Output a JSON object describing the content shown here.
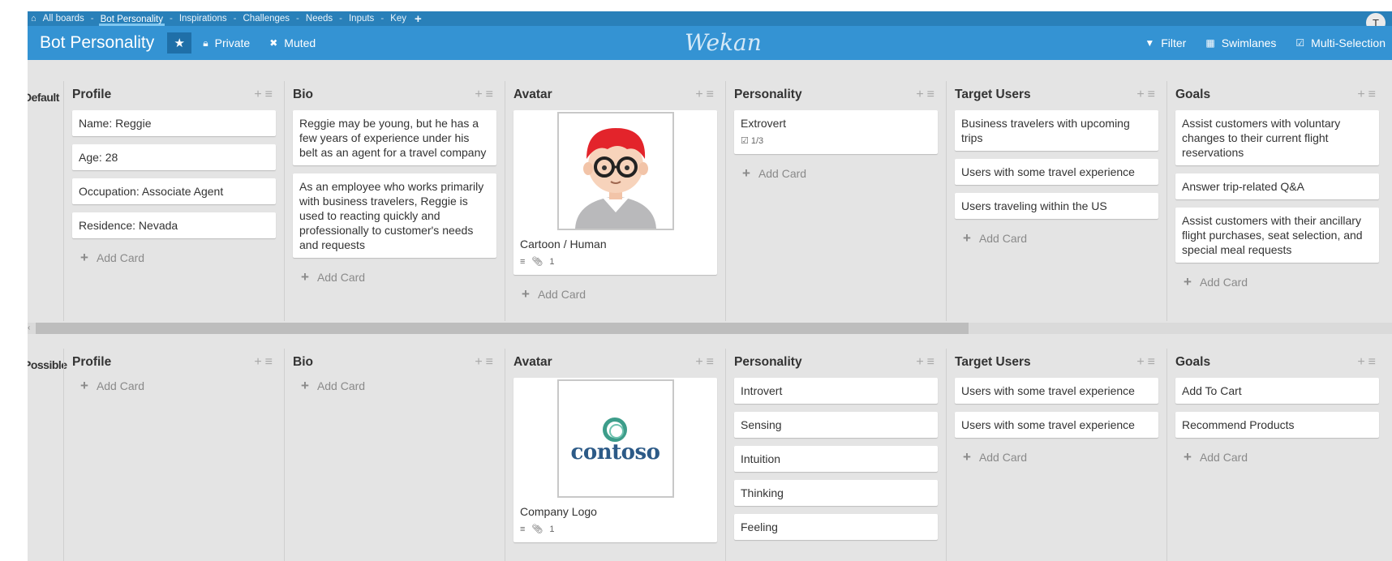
{
  "topnav": {
    "home_icon": "home-icon",
    "items": [
      {
        "label": "All boards",
        "active": false
      },
      {
        "label": "Bot Personality",
        "active": true
      },
      {
        "label": "Inspirations",
        "active": false
      },
      {
        "label": "Challenges",
        "active": false
      },
      {
        "label": "Needs",
        "active": false
      },
      {
        "label": "Inputs",
        "active": false
      },
      {
        "label": "Key",
        "active": false
      }
    ],
    "separator": "-",
    "add_icon": "plus-icon",
    "user_initial": "T"
  },
  "header": {
    "board_title": "Bot Personality",
    "star_icon": "star-icon",
    "private_label": "Private",
    "muted_label": "Muted",
    "logo_text": "Wekan",
    "filter_label": "Filter",
    "swimlanes_label": "Swimlanes",
    "multiselect_label": "Multi-Selection"
  },
  "colors": {
    "topbar": "#2980b9",
    "header": "#3493d3",
    "board_bg": "#e4e4e4"
  },
  "add_card_label": "Add Card",
  "swimlanes": [
    {
      "name": "Default",
      "lists": [
        {
          "title": "Profile",
          "cards": [
            {
              "text": "Name: Reggie"
            },
            {
              "text": "Age: 28"
            },
            {
              "text": "Occupation: Associate Agent"
            },
            {
              "text": "Residence: Nevada"
            }
          ]
        },
        {
          "title": "Bio",
          "cards": [
            {
              "text": "Reggie may be young, but he has a few years of experience under his belt as an agent for a travel company"
            },
            {
              "text": "As an employee who works primarily with business travelers, Reggie is used to reacting quickly and professionally to customer's needs and requests"
            }
          ]
        },
        {
          "title": "Avatar",
          "cards": [
            {
              "text": "Cartoon / Human",
              "image": "cartoon-avatar",
              "attachments": "1"
            }
          ]
        },
        {
          "title": "Personality",
          "cards": [
            {
              "text": "Extrovert",
              "checklist": "1/3"
            }
          ]
        },
        {
          "title": "Target Users",
          "cards": [
            {
              "text": "Business travelers with upcoming trips"
            },
            {
              "text": "Users with some travel experience"
            },
            {
              "text": "Users traveling within the US"
            }
          ]
        },
        {
          "title": "Goals",
          "cards": [
            {
              "text": "Assist customers with voluntary changes to their current flight reservations"
            },
            {
              "text": "Answer trip-related Q&A"
            },
            {
              "text": "Assist customers with their ancillary flight purchases, seat selection, and special meal requests"
            }
          ]
        }
      ]
    },
    {
      "name": "Possible",
      "lists": [
        {
          "title": "Profile",
          "cards": []
        },
        {
          "title": "Bio",
          "cards": []
        },
        {
          "title": "Avatar",
          "cards": [
            {
              "text": "Company Logo",
              "image": "contoso-logo",
              "image_text": "contoso",
              "attachments": "1"
            }
          ]
        },
        {
          "title": "Personality",
          "cards": [
            {
              "text": "Introvert"
            },
            {
              "text": "Sensing"
            },
            {
              "text": "Intuition"
            },
            {
              "text": "Thinking"
            },
            {
              "text": "Feeling"
            }
          ]
        },
        {
          "title": "Target Users",
          "cards": [
            {
              "text": "Users with some travel experience"
            },
            {
              "text": "Users with some travel experience"
            }
          ]
        },
        {
          "title": "Goals",
          "cards": [
            {
              "text": "Add To Cart"
            },
            {
              "text": "Recommend Products"
            }
          ]
        }
      ]
    }
  ]
}
